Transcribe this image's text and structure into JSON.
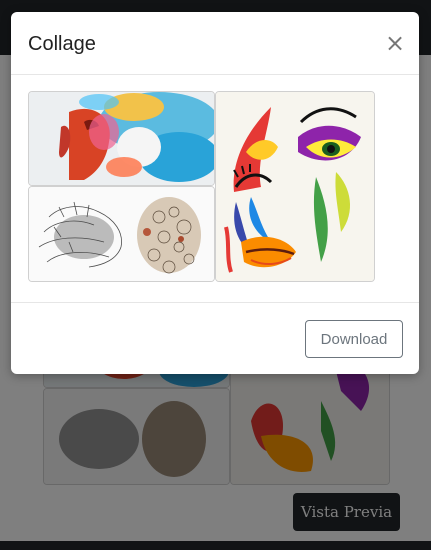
{
  "modal": {
    "title": "Collage",
    "close_symbol": "×",
    "download_label": "Download"
  },
  "page": {
    "preview_label": "Vista Previa"
  },
  "collage": {
    "images": [
      {
        "name": "smoke-portrait",
        "description_icon": "colorful-smoke-profile-image"
      },
      {
        "name": "pop-art-face",
        "description_icon": "abstract-colorful-face-image"
      },
      {
        "name": "sketch-heads",
        "description_icon": "sketch-heads-image"
      }
    ]
  },
  "colors": {
    "overlay": "#00000080",
    "dark_bar": "#23272b",
    "download_border": "#6c757d"
  }
}
